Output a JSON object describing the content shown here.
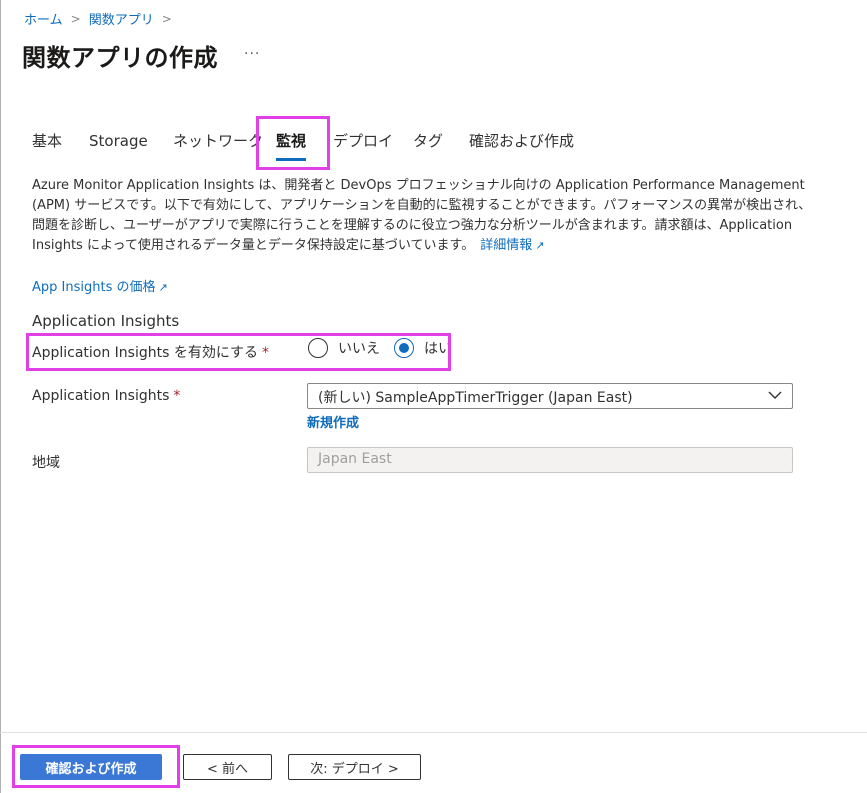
{
  "breadcrumb": {
    "items": [
      "ホーム",
      "関数アプリ"
    ],
    "separator": ">"
  },
  "page": {
    "title": "関数アプリの作成",
    "more": "..."
  },
  "tabs": [
    {
      "label": "基本"
    },
    {
      "label": "Storage"
    },
    {
      "label": "ネットワーク"
    },
    {
      "label": "監視",
      "active": true
    },
    {
      "label": "デプロイ"
    },
    {
      "label": "タグ"
    },
    {
      "label": "確認および作成"
    }
  ],
  "description": {
    "text": "Azure Monitor Application Insights は、開発者と DevOps プロフェッショナル向けの Application Performance Management (APM) サービスです。以下で有効にして、アプリケーションを自動的に監視することができます。パフォーマンスの異常が検出され、問題を診断し、ユーザーがアプリで実際に行うことを理解するのに役立つ強力な分析ツールが含まれます。請求額は、Application Insights によって使用されるデータ量とデータ保持設定に基づいています。",
    "link": "詳細情報"
  },
  "pricing_link": "App Insights の価格",
  "section_title": "Application Insights",
  "fields": {
    "enable": {
      "label": "Application Insights を有効にする",
      "required": "*",
      "options": [
        "いいえ",
        "はい"
      ],
      "selected": "はい"
    },
    "insights": {
      "label": "Application Insights",
      "required": "*",
      "value": "(新しい) SampleAppTimerTrigger (Japan East)",
      "create_new": "新規作成"
    },
    "region": {
      "label": "地域",
      "value": "Japan East"
    }
  },
  "footer": {
    "review_create": "確認および作成",
    "previous": "< 前へ",
    "next": "次: デプロイ >"
  },
  "colors": {
    "link": "#0f6cbd",
    "primary_button": "#3b78d6",
    "highlight": "#e040e6",
    "required": "#a4262c"
  }
}
